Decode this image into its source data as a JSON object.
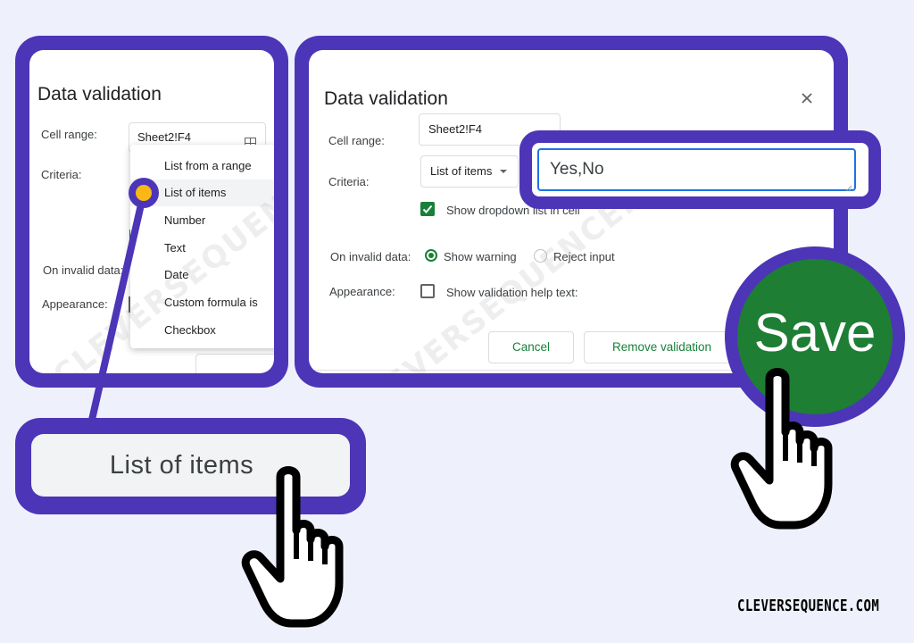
{
  "left_dialog": {
    "title": "Data validation",
    "cell_range_label": "Cell range:",
    "cell_range_value": "Sheet2!F4",
    "criteria_label": "Criteria:",
    "on_invalid_label": "On invalid data:",
    "appearance_label": "Appearance:",
    "menu_items": [
      "List from a range",
      "List of items",
      "Number",
      "Text",
      "Date",
      "Custom formula is",
      "Checkbox"
    ],
    "selected_index": 1
  },
  "right_dialog": {
    "title": "Data validation",
    "cell_range_label": "Cell range:",
    "cell_range_value": "Sheet2!F4",
    "criteria_label": "Criteria:",
    "criteria_select": "List of items",
    "items_value": "Yes,No",
    "show_dropdown_label": "Show dropdown list in cell",
    "show_dropdown_checked": true,
    "on_invalid_label": "On invalid data:",
    "show_warning_label": "Show warning",
    "reject_input_label": "Reject input",
    "appearance_label": "Appearance:",
    "help_text_label": "Show validation help text:",
    "cancel_label": "Cancel",
    "remove_label": "Remove validation"
  },
  "callouts": {
    "list_of_items": "List of items",
    "save": "Save"
  },
  "watermark": "CLEVERSEQUENCE.COM",
  "brand": "CLEVERSEQUENCE.COM",
  "colors": {
    "frame": "#4d35b7",
    "accent_green": "#188038",
    "save_green": "#1e7e34",
    "dot": "#f9b813",
    "focus_blue": "#1a73e8",
    "background": "#eef1fb"
  },
  "icons": [
    "grid-icon",
    "dropdown-arrow-icon",
    "close-icon",
    "checkbox-checked-icon",
    "radio-icon",
    "hand-cursor-icon"
  ]
}
